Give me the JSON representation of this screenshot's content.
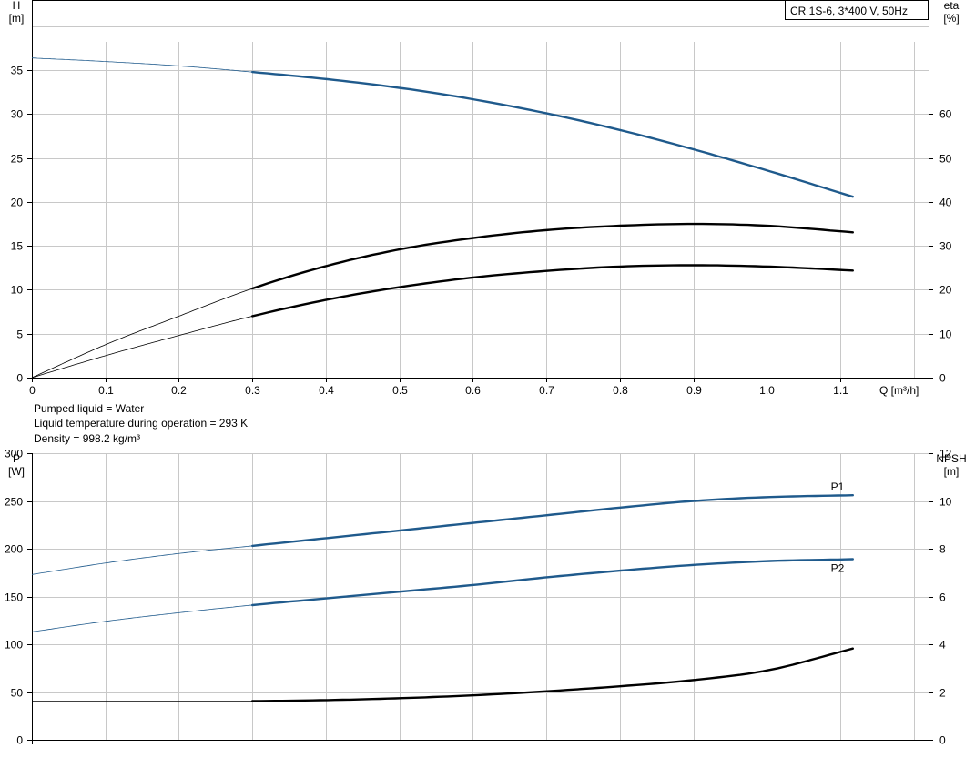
{
  "info": {
    "pumped_liquid": "Pumped liquid = Water",
    "liquid_temperature": "Liquid temperature during operation = 293 K",
    "density": "Density = 998.2 kg/m³"
  },
  "colors": {
    "blue": "#1f5a8c",
    "black": "#000000",
    "grid": "#c8c8c8"
  },
  "chart_data": [
    {
      "type": "line",
      "title": "CR 1S-6, 3*400 V, 50Hz",
      "x_label": "Q [m³/h]",
      "y_label_left": [
        "H",
        "[m]"
      ],
      "y_label_right": [
        "eta",
        "[%]"
      ],
      "x_ticks": [
        "0",
        "0.1",
        "0.2",
        "0.3",
        "0.4",
        "0.5",
        "0.6",
        "0.7",
        "0.8",
        "0.9",
        "1.0",
        "1.1"
      ],
      "y_ticks_left": [
        "0",
        "5",
        "10",
        "15",
        "20",
        "25",
        "30",
        "35"
      ],
      "y_ticks_right": [
        "0",
        "10",
        "20",
        "30",
        "40",
        "50",
        "60"
      ],
      "xlim": [
        0,
        1.22
      ],
      "ylim_left": [
        0,
        43
      ],
      "ylim_right": [
        0,
        86
      ],
      "grid": true,
      "series": [
        {
          "axis": "left",
          "color": "#1f5a8c",
          "operating_from": 0.3,
          "x": [
            0,
            0.1,
            0.2,
            0.3,
            0.4,
            0.5,
            0.6,
            0.7,
            0.8,
            0.9,
            1.0,
            1.117
          ],
          "values": [
            36.4,
            36.0,
            35.5,
            34.8,
            34.0,
            33.0,
            31.7,
            30.1,
            28.2,
            26.0,
            23.6,
            20.6
          ]
        },
        {
          "axis": "right",
          "color": "#000000",
          "operating_from": 0.3,
          "x": [
            0,
            0.1,
            0.2,
            0.3,
            0.4,
            0.5,
            0.6,
            0.7,
            0.8,
            0.9,
            1.0,
            1.117
          ],
          "values": [
            0,
            7.5,
            14.0,
            20.3,
            25.4,
            29.2,
            31.8,
            33.6,
            34.6,
            35.0,
            34.6,
            33.1
          ]
        },
        {
          "axis": "right",
          "color": "#000000",
          "operating_from": 0.3,
          "x": [
            0,
            0.1,
            0.2,
            0.3,
            0.4,
            0.5,
            0.6,
            0.7,
            0.8,
            0.9,
            1.0,
            1.117
          ],
          "values": [
            0,
            5.0,
            9.6,
            14.0,
            17.7,
            20.6,
            22.8,
            24.3,
            25.3,
            25.6,
            25.3,
            24.4
          ]
        }
      ]
    },
    {
      "type": "line",
      "x_label": "",
      "y_label_left": [
        "P",
        "[W]"
      ],
      "y_label_right": [
        "NPSH",
        "[m]"
      ],
      "x_ticks": [],
      "y_ticks_left": [
        "0",
        "50",
        "100",
        "150",
        "200",
        "250",
        "300"
      ],
      "y_ticks_right": [
        "0",
        "2",
        "4",
        "6",
        "8",
        "10",
        "12"
      ],
      "xlim": [
        0,
        1.22
      ],
      "ylim_left": [
        0,
        300
      ],
      "ylim_right": [
        0,
        12
      ],
      "grid": true,
      "series": [
        {
          "name": "P1",
          "axis": "left",
          "color": "#1f5a8c",
          "operating_from": 0.3,
          "x": [
            0,
            0.1,
            0.2,
            0.3,
            0.4,
            0.5,
            0.6,
            0.7,
            0.8,
            0.9,
            1.0,
            1.117
          ],
          "values": [
            173,
            185,
            195,
            203,
            211,
            219,
            227,
            235,
            243,
            250,
            254,
            256
          ]
        },
        {
          "name": "P2",
          "axis": "left",
          "color": "#1f5a8c",
          "operating_from": 0.3,
          "x": [
            0,
            0.1,
            0.2,
            0.3,
            0.4,
            0.5,
            0.6,
            0.7,
            0.8,
            0.9,
            1.0,
            1.117
          ],
          "values": [
            113,
            124,
            133,
            141,
            148,
            155,
            162,
            170,
            177,
            183,
            187,
            189
          ]
        },
        {
          "axis": "right",
          "color": "#000000",
          "operating_from": 0.3,
          "x": [
            0,
            0.1,
            0.2,
            0.3,
            0.4,
            0.5,
            0.6,
            0.7,
            0.8,
            0.9,
            1.0,
            1.117
          ],
          "values": [
            1.62,
            1.61,
            1.61,
            1.62,
            1.66,
            1.74,
            1.86,
            2.03,
            2.24,
            2.5,
            2.9,
            3.82
          ]
        }
      ]
    }
  ]
}
